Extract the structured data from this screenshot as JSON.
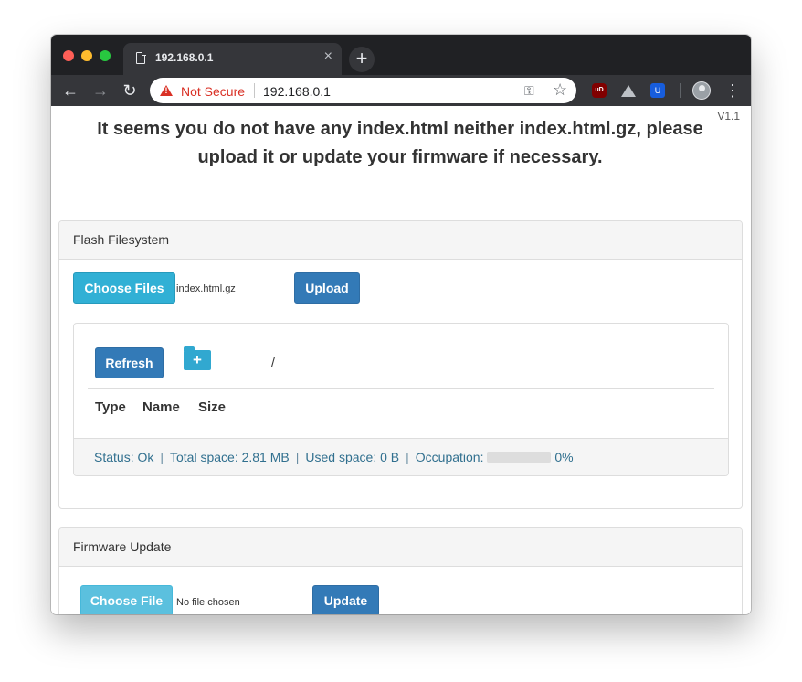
{
  "browser": {
    "tab_title": "192.168.0.1",
    "tab_close": "×",
    "new_tab": "+",
    "security_label": "Not Secure",
    "url": "192.168.0.1",
    "extension_ublock": "uD",
    "extension_bitwarden": "U"
  },
  "page": {
    "version": "V1.1",
    "headline": "It seems you do not have any index.html neither index.html.gz, please upload it or update your firmware if necessary."
  },
  "flash": {
    "heading": "Flash Filesystem",
    "choose_files_label": "Choose Files",
    "selected_file": "index.html.gz",
    "upload_label": "Upload",
    "refresh_label": "Refresh",
    "current_path": "/",
    "columns": [
      "Type",
      "Name",
      "Size"
    ],
    "status": {
      "status_text": "Status: Ok",
      "total_space": "Total space: 2.81 MB",
      "used_space": "Used space: 0 B",
      "occupation_label": "Occupation:",
      "occupation_value": "0%",
      "occupation_fraction": 0
    }
  },
  "firmware": {
    "heading": "Firmware Update",
    "choose_file_label": "Choose File",
    "selected_file": "No file chosen",
    "update_label": "Update"
  },
  "colors": {
    "primary": "#337ab7",
    "info": "#31b0d5",
    "warning_red": "#d93025",
    "status_text": "#31708f"
  }
}
